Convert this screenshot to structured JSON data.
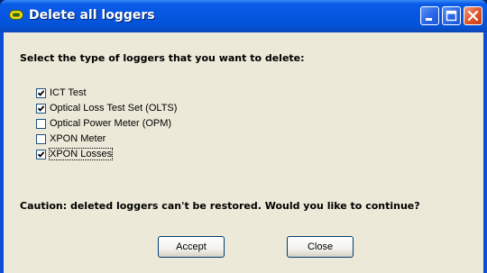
{
  "window": {
    "title": "Delete all loggers",
    "icon": "app-icon",
    "controls": [
      "minimize-icon",
      "maximize-icon",
      "close-icon"
    ]
  },
  "dialog": {
    "prompt": "Select the type of loggers that you want to delete:",
    "options": [
      {
        "label": "ICT Test",
        "checked": true
      },
      {
        "label": "Optical Loss Test Set (OLTS)",
        "checked": true
      },
      {
        "label": "Optical Power Meter (OPM)",
        "checked": false
      },
      {
        "label": "XPON Meter",
        "checked": false
      },
      {
        "label": "XPON Losses",
        "checked": true,
        "focused": true
      }
    ],
    "caution": "Caution: deleted loggers can't be restored. Would you like to continue?",
    "accept_label": "Accept",
    "close_label": "Close"
  },
  "colors": {
    "titlebar": "#0656e0",
    "client": "#ece9d8",
    "check": "#21a121"
  }
}
